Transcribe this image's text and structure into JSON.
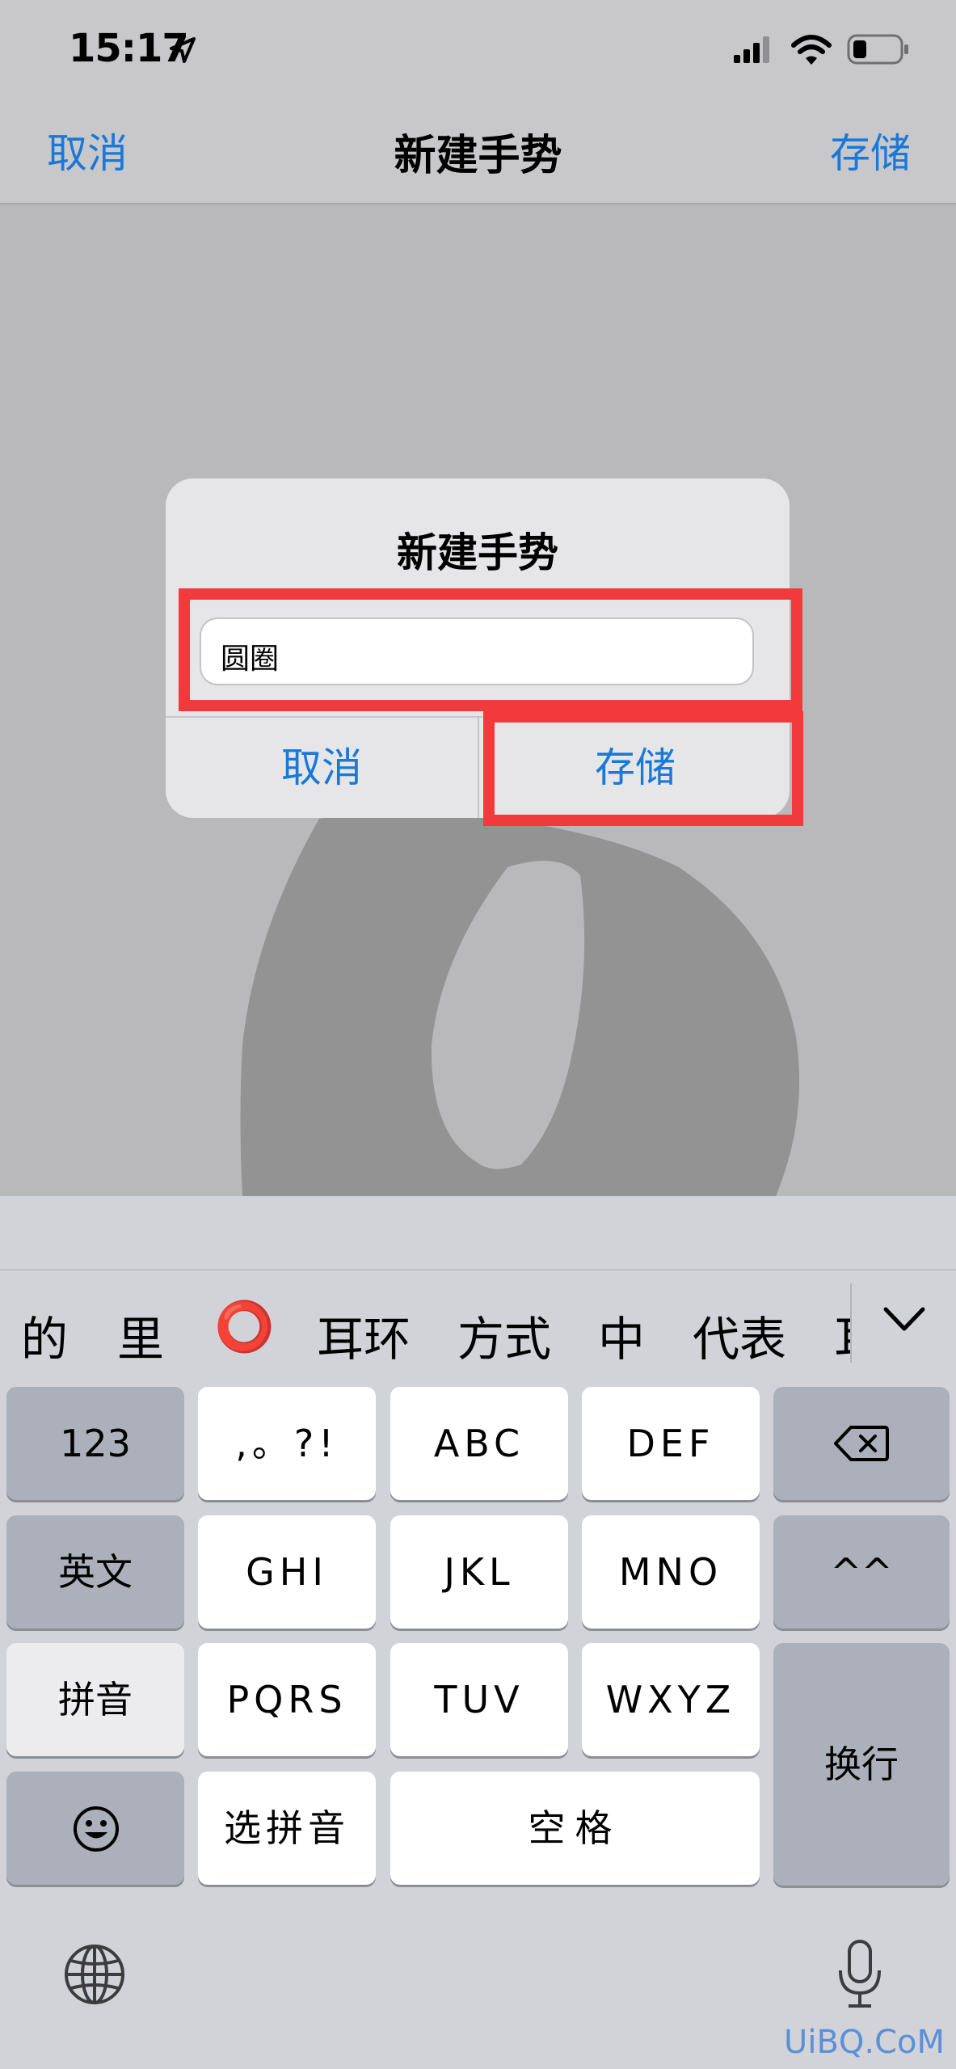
{
  "status": {
    "time": "15:17"
  },
  "nav": {
    "cancel": "取消",
    "title": "新建手势",
    "save": "存储"
  },
  "dialog": {
    "title": "新建手势",
    "input_value": "圆圈",
    "cancel": "取消",
    "save": "存储"
  },
  "candidates": [
    "的",
    "里",
    "⭕",
    "耳环",
    "方式",
    "中",
    "代表",
    "耳"
  ],
  "keys": {
    "k123": "123",
    "punct": ",。?!",
    "abc": "ABC",
    "def": "DEF",
    "english": "英文",
    "ghi": "GHI",
    "jkl": "JKL",
    "mno": "MNO",
    "kaomoji": "^^",
    "pinyin": "拼音",
    "pqrs": "PQRS",
    "tuv": "TUV",
    "wxyz": "WXYZ",
    "newline": "换行",
    "select_pinyin": "选拼音",
    "space": "空格"
  },
  "watermark": "UiBQ.CoM",
  "colors": {
    "accent": "#1a78d8",
    "highlight": "#f23a3c"
  }
}
